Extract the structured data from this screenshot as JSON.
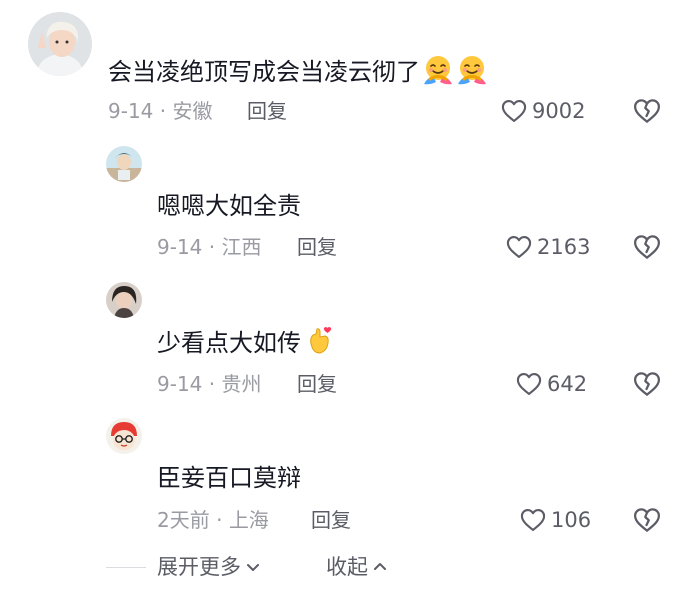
{
  "comments": [
    {
      "text": "会当凌绝顶写成会当凌云彻了",
      "date": "9-14",
      "separator": "·",
      "location": "安徽",
      "reply_label": "回复",
      "likes": "9002",
      "emojis": [
        "hugging-face-emoji",
        "hugging-face-emoji"
      ]
    },
    {
      "text": "嗯嗯大如全责",
      "date": "9-14",
      "separator": "·",
      "location": "江西",
      "reply_label": "回复",
      "likes": "2163"
    },
    {
      "text": "少看点大如传",
      "date": "9-14",
      "separator": "·",
      "location": "贵州",
      "reply_label": "回复",
      "likes": "642",
      "emojis": [
        "finger-heart-emoji"
      ]
    },
    {
      "text": "臣妾百口莫辩",
      "date": "2天前",
      "separator": "·",
      "location": "上海",
      "reply_label": "回复",
      "likes": "106"
    }
  ],
  "footer": {
    "expand_label": "展开更多",
    "collapse_label": "收起"
  },
  "icons": {
    "like": "heart-outline-icon",
    "dislike": "broken-heart-icon",
    "expand": "chevron-down-icon",
    "collapse": "chevron-up-icon"
  },
  "colors": {
    "text_primary": "#161823",
    "text_secondary": "#9a9ba2",
    "action_text": "#5b5c66"
  }
}
